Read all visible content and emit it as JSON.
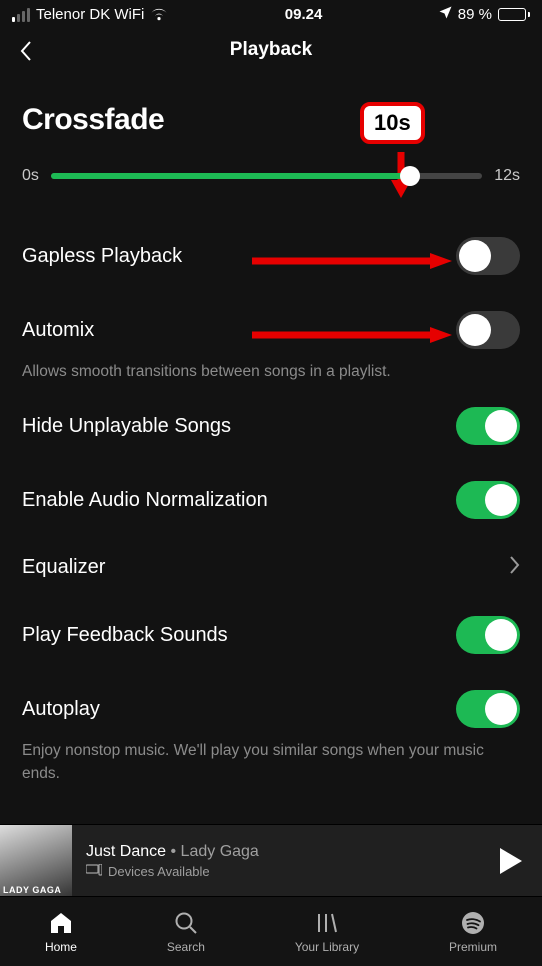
{
  "status": {
    "carrier": "Telenor DK WiFi",
    "time": "09.24",
    "battery_pct": "89 %"
  },
  "header": {
    "title": "Playback"
  },
  "crossfade": {
    "title": "Crossfade",
    "callout": "10s",
    "min_label": "0s",
    "max_label": "12s",
    "value_s": 10,
    "max_s": 12
  },
  "settings": {
    "gapless": {
      "label": "Gapless Playback",
      "on": false
    },
    "automix": {
      "label": "Automix",
      "on": false,
      "desc": "Allows smooth transitions between songs in a playlist."
    },
    "hide_unplayable": {
      "label": "Hide Unplayable Songs",
      "on": true
    },
    "normalize": {
      "label": "Enable Audio Normalization",
      "on": true
    },
    "equalizer": {
      "label": "Equalizer"
    },
    "feedback": {
      "label": "Play Feedback Sounds",
      "on": true
    },
    "autoplay": {
      "label": "Autoplay",
      "on": true,
      "desc": "Enjoy nonstop music. We'll play you similar songs when your music ends."
    }
  },
  "now_playing": {
    "art_caption": "LADY GAGA",
    "song": "Just Dance",
    "separator": " • ",
    "artist": "Lady Gaga",
    "devices": "Devices Available"
  },
  "nav": {
    "home": "Home",
    "search": "Search",
    "library": "Your Library",
    "premium": "Premium"
  }
}
